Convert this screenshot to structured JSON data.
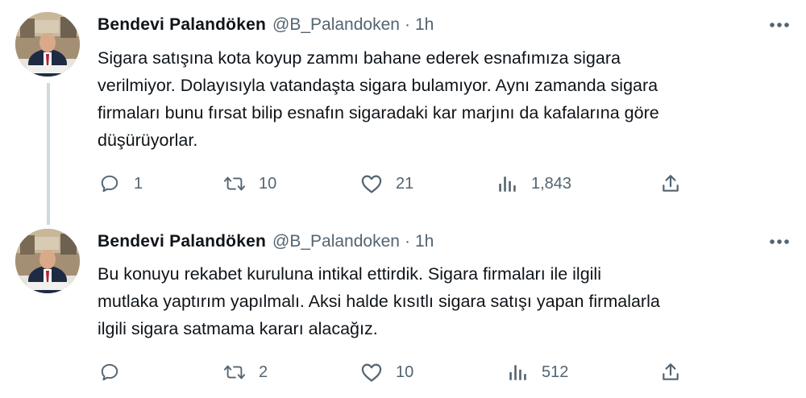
{
  "tweets": [
    {
      "author_name": "Bendevi Palandöken",
      "handle": "@B_Palandoken",
      "separator": "·",
      "time": "1h",
      "text": "Sigara satışına kota koyup zammı bahane ederek esnafımıza sigara\nverilmiyor. Dolayısıyla vatandaşta sigara bulamıyor. Aynı zamanda sigara\nfirmaları bunu fırsat bilip esnafın sigaradaki kar marjını da kafalarına göre\ndüşürüyorlar.",
      "replies": "1",
      "retweets": "10",
      "likes": "21",
      "views": "1,843"
    },
    {
      "author_name": "Bendevi Palandöken",
      "handle": "@B_Palandoken",
      "separator": "·",
      "time": "1h",
      "text": "Bu konuyu rekabet kuruluna intikal ettirdik. Sigara firmaları ile ilgili\nmutlaka yaptırım yapılmalı. Aksi halde kısıtlı sigara satışı yapan firmalarla\nilgili sigara satmama kararı alacağız.",
      "replies": "",
      "retweets": "2",
      "likes": "10",
      "views": "512"
    }
  ],
  "icons": {
    "reply": "reply-icon",
    "retweet": "retweet-icon",
    "like": "heart-icon",
    "views": "views-chart-icon",
    "share": "share-icon",
    "more": "more-options-icon"
  },
  "colors": {
    "text": "#0f1419",
    "secondary": "#536471",
    "thread_line": "#cfd9de"
  }
}
